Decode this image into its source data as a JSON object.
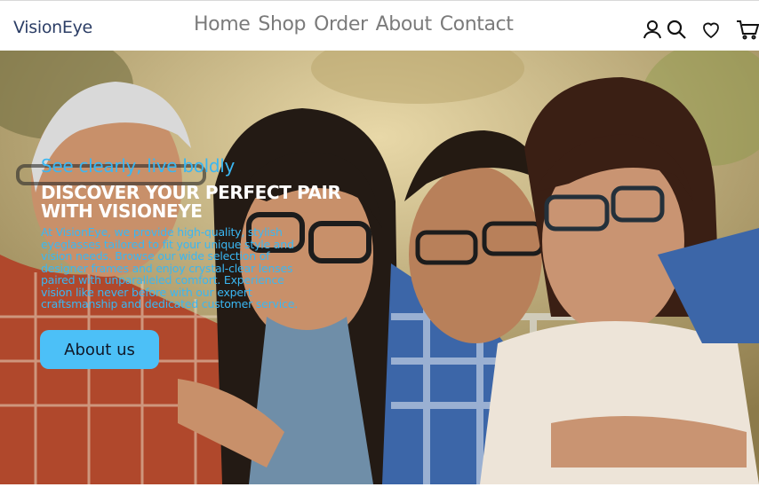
{
  "brand": {
    "name": "VisionEye"
  },
  "nav": [
    "Home",
    "Shop",
    "Order",
    "About",
    "Contact"
  ],
  "header_icons": [
    "user-icon",
    "search-icon",
    "heart-icon",
    "cart-icon"
  ],
  "hero": {
    "tagline": "See clearly, live boldly",
    "headline": "DISCOVER YOUR PERFECT PAIR WITH VISIONEYE",
    "body": "At VisionEye, we provide high-quality, stylish eyeglasses tailored to fit your unique style and vision needs. Browse our wide selection of designer frames and enjoy crystal-clear lenses paired with unparalleled comfort. Experience vision like never before with our expert craftsmanship and dedicated customer service.",
    "cta_label": "About us"
  },
  "colors": {
    "brand": "#2c3e66",
    "accent": "#4cc0f7",
    "tagline": "#3ab7f3",
    "nav_text": "#7b7b7b"
  }
}
